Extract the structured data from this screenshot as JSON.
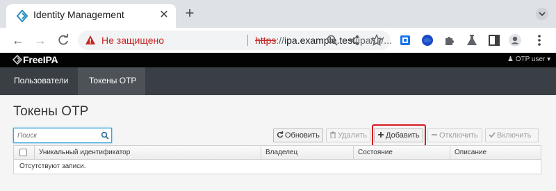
{
  "browser": {
    "tab_title": "Identity Management",
    "insecure_label": "Не защищено",
    "url_scheme": "https",
    "url_rest": "://",
    "url_host": "ipa.example.test",
    "url_path": "/ipa/ui/..."
  },
  "app": {
    "brand": "FreeIPA",
    "user_menu": "OTP user",
    "nav": [
      {
        "label": "Пользователи",
        "active": false
      },
      {
        "label": "Токены OTP",
        "active": true
      }
    ],
    "page_title": "Токены OTP",
    "search": {
      "placeholder": "Поиск",
      "value": ""
    },
    "actions": {
      "refresh": "Обновить",
      "delete": "Удалить",
      "add": "Добавить",
      "disable": "Отключить",
      "enable": "Включить"
    },
    "table": {
      "columns": [
        "Уникальный идентификатор",
        "Владелец",
        "Состояние",
        "Описание"
      ],
      "empty_message": "Отсутствуют записи."
    }
  },
  "colors": {
    "accent": "#39a5dc",
    "highlight": "#d71921",
    "topbar": "#030303",
    "navbar": "#393f44",
    "nav_active": "#4d5258"
  }
}
